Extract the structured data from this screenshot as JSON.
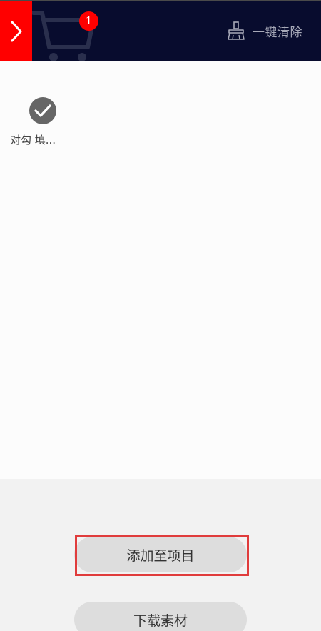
{
  "header": {
    "cart_badge_count": "1",
    "clear_all_label": "一键清除",
    "colors": {
      "background": "#080c2e",
      "collapse_button": "#ff0000",
      "badge": "#ff0000",
      "clear_label": "#a7a9b8"
    }
  },
  "cart": {
    "items": [
      {
        "icon": "check-circle-icon",
        "label": "对勾 填..."
      }
    ]
  },
  "footer": {
    "add_to_project_label": "添加至项目",
    "download_label": "下载素材",
    "highlight_color": "#e03c3c"
  }
}
